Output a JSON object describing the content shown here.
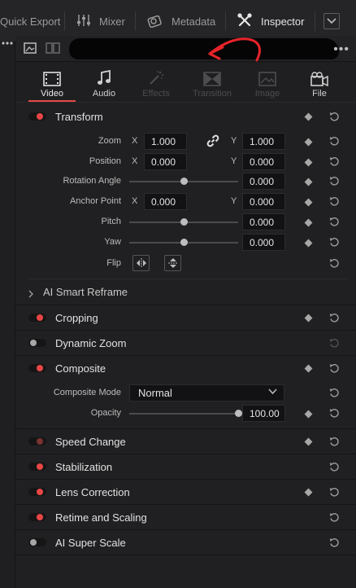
{
  "toolbar": {
    "quick_export": "Quick Export",
    "mixer": "Mixer",
    "metadata": "Metadata",
    "inspector": "Inspector"
  },
  "tabs": [
    {
      "label": "Video",
      "icon": "film-icon",
      "state": "active"
    },
    {
      "label": "Audio",
      "icon": "music-note-icon",
      "state": "enabled"
    },
    {
      "label": "Effects",
      "icon": "magic-wand-icon",
      "state": "disabled"
    },
    {
      "label": "Transition",
      "icon": "transition-icon",
      "state": "disabled"
    },
    {
      "label": "Image",
      "icon": "image-icon",
      "state": "disabled"
    },
    {
      "label": "File",
      "icon": "file-icon",
      "state": "enabled"
    }
  ],
  "transform": {
    "title": "Transform",
    "enabled": true,
    "zoom": {
      "label": "Zoom",
      "x_axis": "X",
      "x": "1.000",
      "y_axis": "Y",
      "y": "1.000",
      "linked": true
    },
    "position": {
      "label": "Position",
      "x_axis": "X",
      "x": "0.000",
      "y_axis": "Y",
      "y": "0.000"
    },
    "rotation": {
      "label": "Rotation Angle",
      "value": "0.000",
      "slider_fraction": 0.5
    },
    "anchor": {
      "label": "Anchor Point",
      "x_axis": "X",
      "x": "0.000",
      "y_axis": "Y",
      "y": "0.000"
    },
    "pitch": {
      "label": "Pitch",
      "value": "0.000",
      "slider_fraction": 0.5
    },
    "yaw": {
      "label": "Yaw",
      "value": "0.000",
      "slider_fraction": 0.5
    },
    "flip": {
      "label": "Flip"
    }
  },
  "smart_reframe": {
    "title": "AI Smart Reframe",
    "expanded": false
  },
  "cropping": {
    "title": "Cropping",
    "enabled": true
  },
  "dynamic_zoom": {
    "title": "Dynamic Zoom",
    "enabled": false
  },
  "composite": {
    "title": "Composite",
    "enabled": true,
    "mode_label": "Composite Mode",
    "mode_value": "Normal",
    "opacity_label": "Opacity",
    "opacity_value": "100.00",
    "opacity_fraction": 1.0
  },
  "speed_change": {
    "title": "Speed Change",
    "enabled": true
  },
  "stabilization": {
    "title": "Stabilization",
    "enabled": true
  },
  "lens_correction": {
    "title": "Lens Correction",
    "enabled": true
  },
  "retime": {
    "title": "Retime and Scaling",
    "enabled": true
  },
  "super_scale": {
    "title": "AI Super Scale",
    "enabled": false
  },
  "colors": {
    "accent": "#e84646",
    "annotation_arrow": "#e8232a"
  }
}
